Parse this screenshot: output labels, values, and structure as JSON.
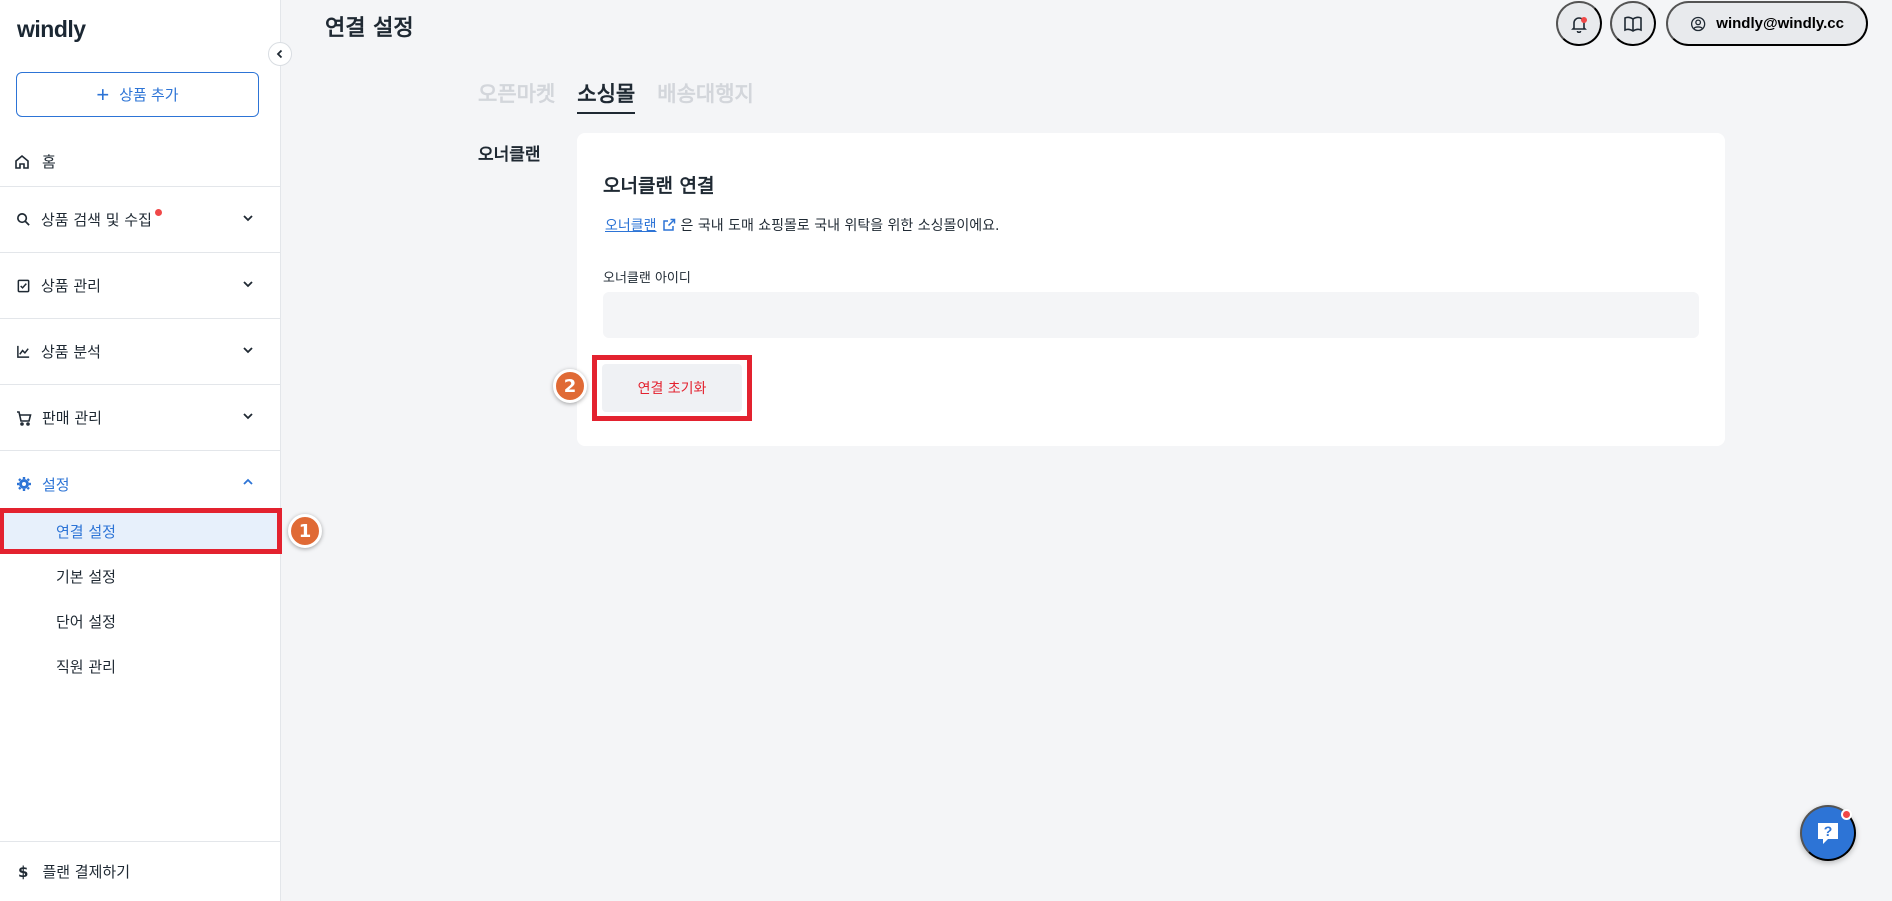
{
  "brand": {
    "logo": "windly"
  },
  "sidebar": {
    "add_product_label": "상품 추가",
    "home_label": "홈",
    "items": [
      {
        "label": "상품 검색 및 수집"
      },
      {
        "label": "상품 관리"
      },
      {
        "label": "상품 분석"
      },
      {
        "label": "판매 관리"
      },
      {
        "label": "설정"
      }
    ],
    "settings_sub": [
      {
        "label": "연결 설정"
      },
      {
        "label": "기본 설정"
      },
      {
        "label": "단어 설정"
      },
      {
        "label": "직원 관리"
      }
    ],
    "bottom_label": "플랜 결제하기"
  },
  "header": {
    "title": "연결 설정",
    "user_email": "windly@windly.cc"
  },
  "tabs": [
    {
      "label": "오픈마켓"
    },
    {
      "label": "소싱몰"
    },
    {
      "label": "배송대행지"
    }
  ],
  "section": {
    "label": "오너클랜",
    "card_title": "오너클랜 연결",
    "link_text": "오너클랜",
    "description": "은 국내 도매 쇼핑몰로 국내 위탁을 위한 소싱몰이에요.",
    "field_label": "오너클랜 아이디",
    "field_value": "",
    "reset_label": "연결 초기화"
  },
  "annotations": {
    "step1": "1",
    "step2": "2"
  },
  "colors": {
    "accent": "#2d74d6",
    "highlight": "#e3222f",
    "badge": "#e06a35"
  }
}
